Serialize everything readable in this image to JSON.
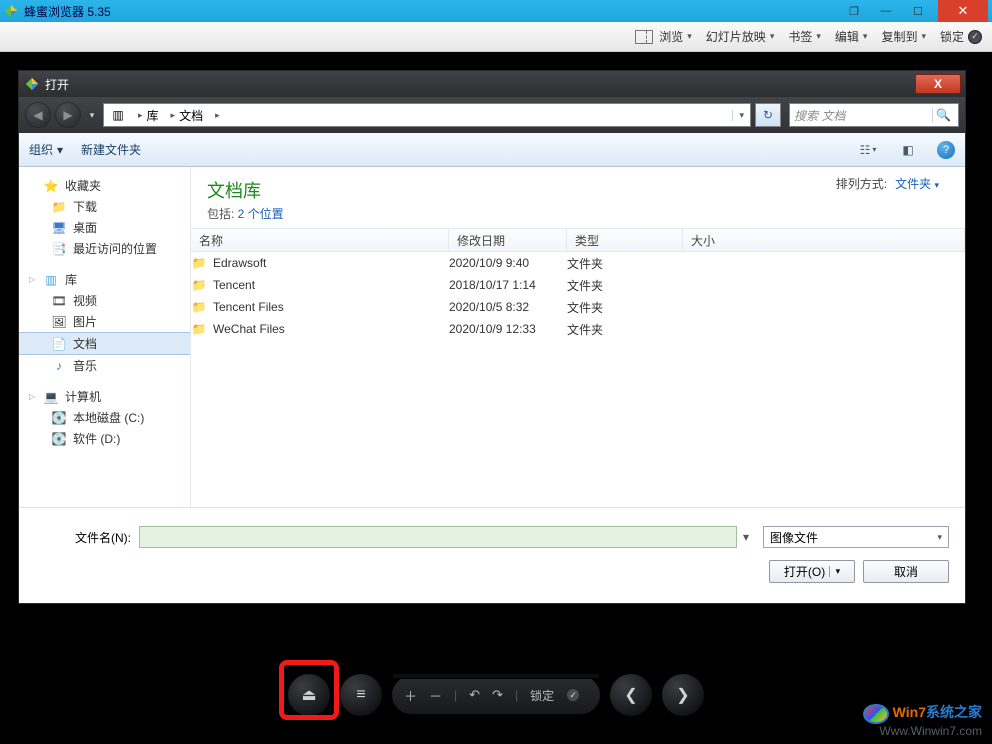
{
  "app": {
    "title": "蜂蜜浏览器 5.35"
  },
  "menubar": {
    "browse": "浏览",
    "slideshow": "幻灯片放映",
    "bookmarks": "书签",
    "edit": "编辑",
    "copyto": "复制到",
    "lock": "锁定"
  },
  "dialog": {
    "title": "打开",
    "breadcrumb": {
      "root": "库",
      "folder": "文档"
    },
    "search_placeholder": "搜索 文档",
    "toolbar": {
      "organize": "组织",
      "newfolder": "新建文件夹"
    },
    "nav": {
      "favorites": "收藏夹",
      "downloads": "下载",
      "desktop": "桌面",
      "recent": "最近访问的位置",
      "libraries": "库",
      "videos": "视频",
      "pictures": "图片",
      "documents": "文档",
      "music": "音乐",
      "computer": "计算机",
      "drive_c": "本地磁盘 (C:)",
      "drive_d": "软件 (D:)"
    },
    "lib": {
      "title": "文档库",
      "subtitle_prefix": "包括: ",
      "subtitle_link": "2 个位置",
      "arrange_label": "排列方式:",
      "arrange_value": "文件夹"
    },
    "columns": {
      "name": "名称",
      "date": "修改日期",
      "type": "类型",
      "size": "大小"
    },
    "rows": [
      {
        "name": "Edrawsoft",
        "date": "2020/10/9 9:40",
        "type": "文件夹",
        "size": ""
      },
      {
        "name": "Tencent",
        "date": "2018/10/17 1:14",
        "type": "文件夹",
        "size": ""
      },
      {
        "name": "Tencent Files",
        "date": "2020/10/5 8:32",
        "type": "文件夹",
        "size": ""
      },
      {
        "name": "WeChat Files",
        "date": "2020/10/9 12:33",
        "type": "文件夹",
        "size": ""
      }
    ],
    "filename_label": "文件名(N):",
    "filter": "图像文件",
    "open_btn": "打开(O)",
    "cancel_btn": "取消"
  },
  "player": {
    "lock_label": "锁定"
  },
  "watermark": {
    "brand1": "Win7",
    "brand2": "系统之家",
    "url": "Www.Winwin7.com"
  }
}
